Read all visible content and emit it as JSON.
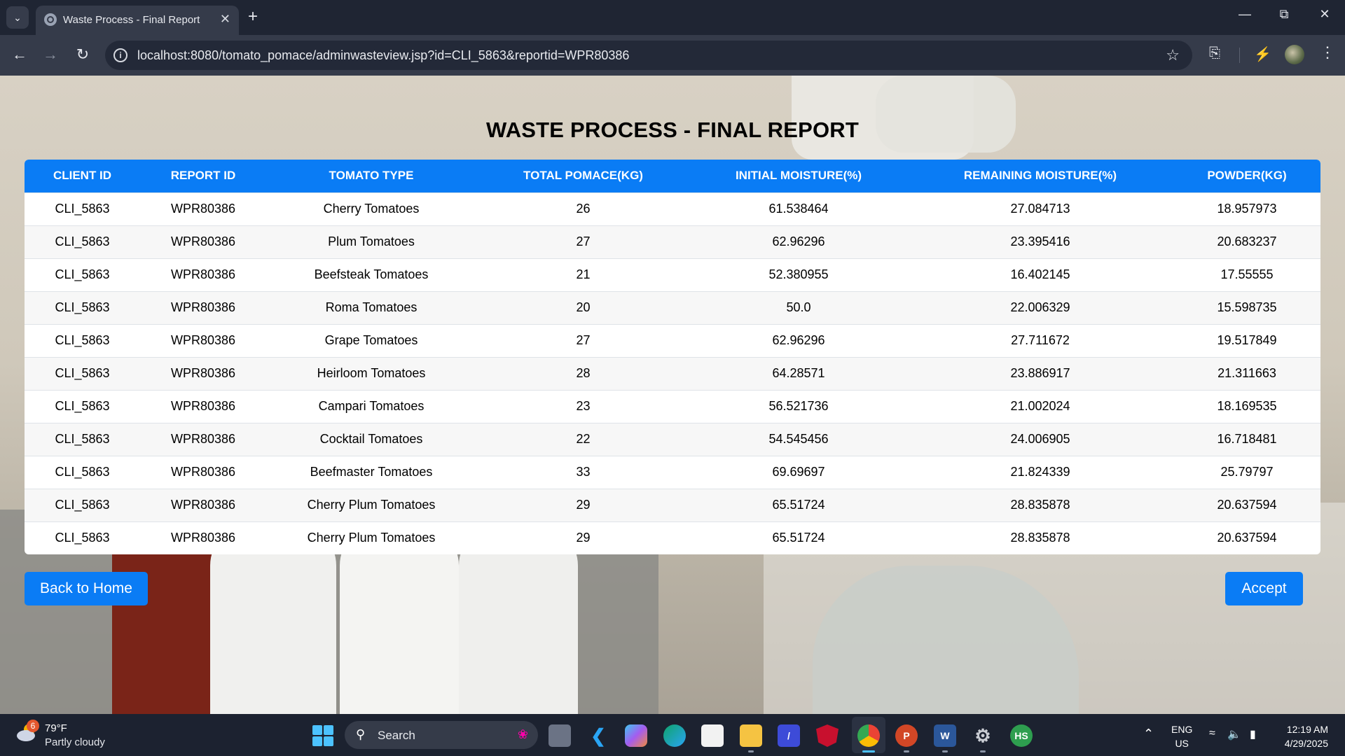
{
  "browser": {
    "tab_title": "Waste Process - Final Report",
    "url": "localhost:8080/tomato_pomace/adminwasteview.jsp?id=CLI_5863&reportid=WPR80386"
  },
  "page": {
    "title": "WASTE PROCESS - FINAL REPORT",
    "columns": [
      "CLIENT ID",
      "REPORT ID",
      "TOMATO TYPE",
      "TOTAL POMACE(KG)",
      "INITIAL MOISTURE(%)",
      "REMAINING MOISTURE(%)",
      "POWDER(KG)"
    ],
    "rows": [
      [
        "CLI_5863",
        "WPR80386",
        "Cherry Tomatoes",
        "26",
        "61.538464",
        "27.084713",
        "18.957973"
      ],
      [
        "CLI_5863",
        "WPR80386",
        "Plum Tomatoes",
        "27",
        "62.96296",
        "23.395416",
        "20.683237"
      ],
      [
        "CLI_5863",
        "WPR80386",
        "Beefsteak Tomatoes",
        "21",
        "52.380955",
        "16.402145",
        "17.55555"
      ],
      [
        "CLI_5863",
        "WPR80386",
        "Roma Tomatoes",
        "20",
        "50.0",
        "22.006329",
        "15.598735"
      ],
      [
        "CLI_5863",
        "WPR80386",
        "Grape Tomatoes",
        "27",
        "62.96296",
        "27.711672",
        "19.517849"
      ],
      [
        "CLI_5863",
        "WPR80386",
        "Heirloom Tomatoes",
        "28",
        "64.28571",
        "23.886917",
        "21.311663"
      ],
      [
        "CLI_5863",
        "WPR80386",
        "Campari Tomatoes",
        "23",
        "56.521736",
        "21.002024",
        "18.169535"
      ],
      [
        "CLI_5863",
        "WPR80386",
        "Cocktail Tomatoes",
        "22",
        "54.545456",
        "24.006905",
        "16.718481"
      ],
      [
        "CLI_5863",
        "WPR80386",
        "Beefmaster Tomatoes",
        "33",
        "69.69697",
        "21.824339",
        "25.79797"
      ],
      [
        "CLI_5863",
        "WPR80386",
        "Cherry Plum Tomatoes",
        "29",
        "65.51724",
        "28.835878",
        "20.637594"
      ],
      [
        "CLI_5863",
        "WPR80386",
        "Cherry Plum Tomatoes",
        "29",
        "65.51724",
        "28.835878",
        "20.637594"
      ]
    ],
    "back_button": "Back to Home",
    "accept_button": "Accept"
  },
  "taskbar": {
    "weather_badge": "6",
    "weather_temp": "79°F",
    "weather_desc": "Partly cloudy",
    "search_label": "Search",
    "lang_top": "ENG",
    "lang_bottom": "US",
    "time": "12:19 AM",
    "date": "4/29/2025",
    "hs_label": "HS"
  },
  "colors": {
    "accent": "#0a7cf5",
    "chrome_dark": "#1f2533",
    "taskbar": "#1c2230"
  }
}
